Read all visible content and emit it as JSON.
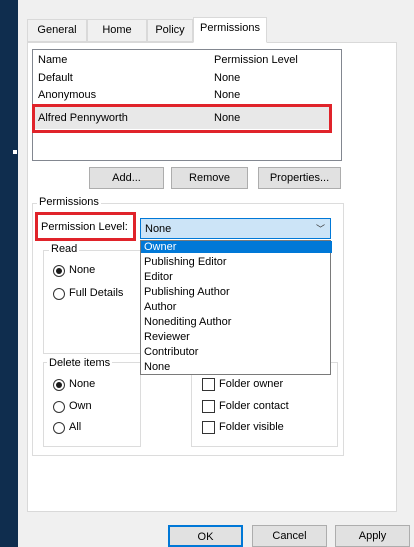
{
  "tabs": [
    {
      "label": "General"
    },
    {
      "label": "Home Page"
    },
    {
      "label": "Policy"
    },
    {
      "label": "Permissions"
    }
  ],
  "users_list": {
    "col_name": "Name",
    "col_level": "Permission Level",
    "rows": [
      {
        "name": "Default",
        "level": "None"
      },
      {
        "name": "Anonymous",
        "level": "None"
      },
      {
        "name": "Alfred Pennyworth",
        "level": "None"
      }
    ]
  },
  "buttons": {
    "add": "Add...",
    "remove": "Remove",
    "properties": "Properties...",
    "ok": "OK",
    "cancel": "Cancel",
    "apply": "Apply"
  },
  "permissions": {
    "group_title": "Permissions",
    "level_label": "Permission Level:",
    "level_value": "None",
    "dropdown_options": [
      "Owner",
      "Publishing Editor",
      "Editor",
      "Publishing Author",
      "Author",
      "Nonediting Author",
      "Reviewer",
      "Contributor",
      "None"
    ],
    "highlighted_option": "Owner"
  },
  "read": {
    "title": "Read",
    "options": [
      "None",
      "Full Details"
    ],
    "selected": "None"
  },
  "delete_items": {
    "title": "Delete items",
    "options": [
      "None",
      "Own",
      "All"
    ],
    "selected": "None"
  },
  "other_checks": [
    "Folder owner",
    "Folder contact",
    "Folder visible"
  ],
  "colors": {
    "accent": "#0078d7",
    "highlight_box": "#e0232a",
    "background": "#0f2d4e"
  }
}
